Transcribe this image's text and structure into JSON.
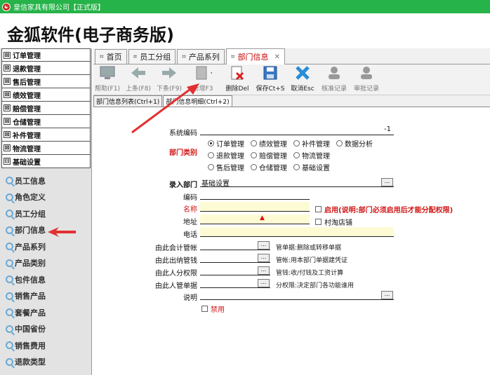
{
  "window": {
    "title": "皇信家具有限公司【正式版】"
  },
  "app": {
    "title": "金狐软件(电子商务版)"
  },
  "menu": [
    "订单管理",
    "退款管理",
    "售后管理",
    "绩效管理",
    "赔偿管理",
    "仓储管理",
    "补件管理",
    "物流管理",
    "基础设置"
  ],
  "submenu": [
    "员工信息",
    "角色定义",
    "员工分组",
    "部门信息",
    "产品系列",
    "产品类别",
    "包件信息",
    "销售产品",
    "套餐产品",
    "中国省份",
    "销售费用",
    "退款类型"
  ],
  "tabs": [
    "首页",
    "员工分组",
    "产品系列",
    "部门信息"
  ],
  "toolbar": {
    "help": "帮助(F1)",
    "prev": "上条(F8)",
    "next": "下条(F9)",
    "add": "新增F3",
    "delete": "删除Del",
    "save": "保存Ct+S",
    "cancel": "取消Esc",
    "review": "核准记录",
    "audit": "审批记录"
  },
  "subtabs": [
    "部门信息列表(Ctrl+1)",
    "部门信息明细(Ctrl+2)"
  ],
  "form": {
    "system_code_label": "系统编码",
    "system_code_value": "-1",
    "dept_type_label": "部门类别",
    "dept_types": [
      "订单管理",
      "绩效管理",
      "补件管理",
      "数据分析",
      "退款管理",
      "赔偿管理",
      "物流管理",
      "售后管理",
      "仓储管理",
      "基础设置"
    ],
    "entry_dept_label": "录入部门",
    "entry_dept_value": "基础设置",
    "code_label": "编码",
    "name_label": "名称",
    "address_label": "地址",
    "phone_label": "电话",
    "enable_label": "启用(说明:部门必须启用后才能分配权限)",
    "village_label": "村淘店铺",
    "acct_label": "由此会计管帐",
    "cash_label": "由此出纳管钱",
    "perm_label": "由此人分权限",
    "doc_label": "由此人管单据",
    "notes": [
      "管单据:删除或转移单据",
      "管帐:用本部门单据建凭证",
      "管钱:收/付钱及工资计算",
      "分权限:决定部门各功能谁用"
    ],
    "desc_label": "说明",
    "disabled_label": "禁用",
    "dots": "..."
  },
  "colors": {
    "titlebar": "#26b349",
    "accent_red": "#d01515"
  }
}
